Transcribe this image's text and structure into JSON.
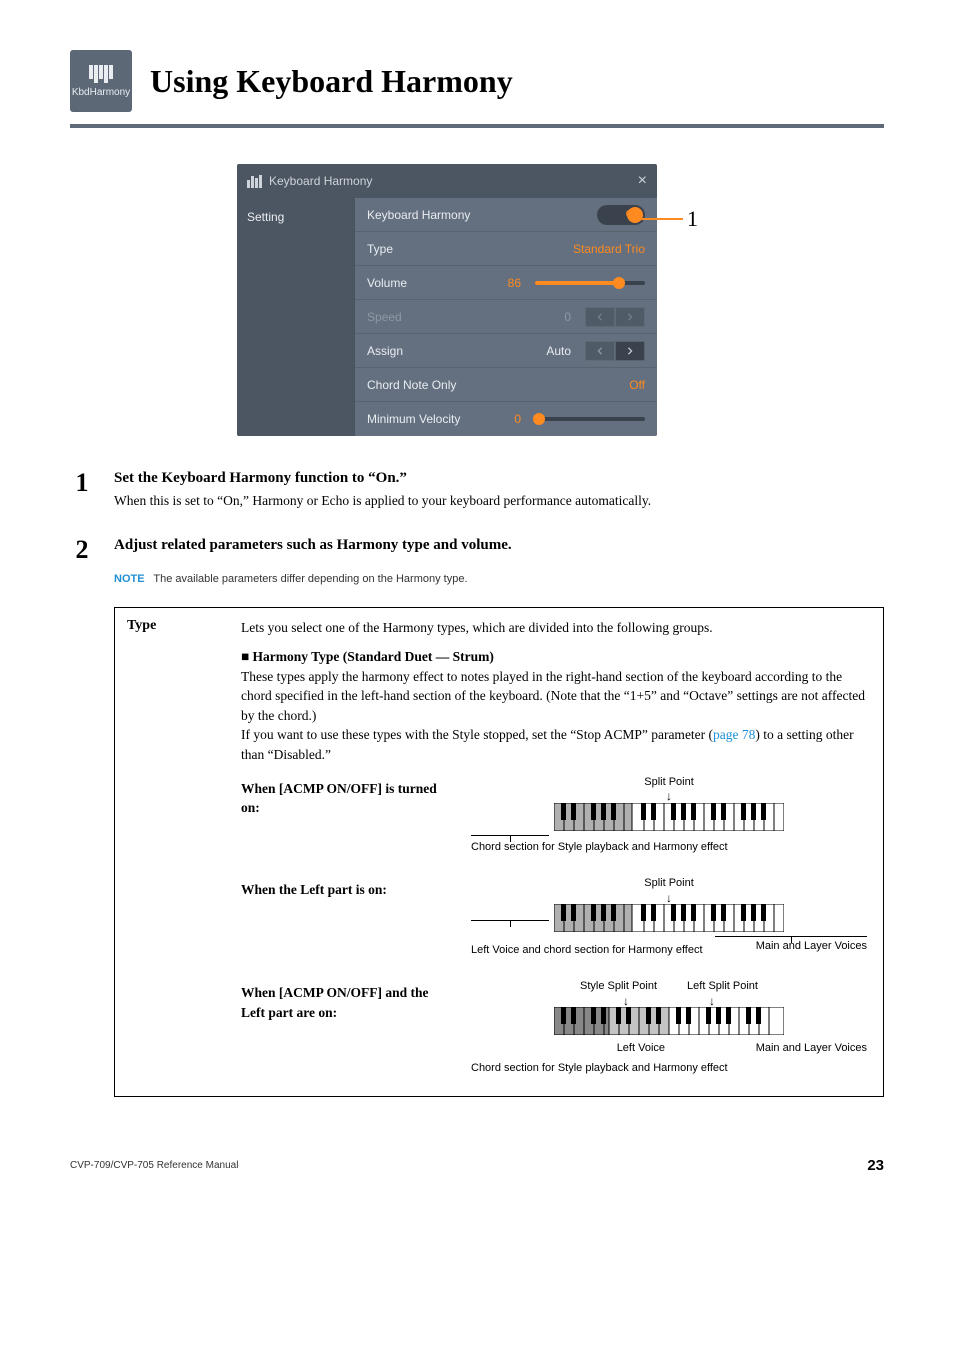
{
  "header": {
    "icon_label": "KbdHarmony",
    "title": "Using Keyboard Harmony"
  },
  "shot": {
    "window_title": "Keyboard Harmony",
    "sidebar_label": "Setting",
    "rows": {
      "kh_label": "Keyboard Harmony",
      "kh_toggle": "On",
      "type_label": "Type",
      "type_value": "Standard Trio",
      "volume_label": "Volume",
      "volume_value": "86",
      "speed_label": "Speed",
      "speed_value": "0",
      "assign_label": "Assign",
      "assign_value": "Auto",
      "chord_label": "Chord Note Only",
      "chord_value": "Off",
      "minvel_label": "Minimum Velocity",
      "minvel_value": "0"
    },
    "callout_num": "1"
  },
  "steps": {
    "s1_num": "1",
    "s1_h": "Set the Keyboard Harmony function to “On.”",
    "s1_p": "When this is set to “On,” Harmony or Echo is applied to your keyboard performance automatically.",
    "s2_num": "2",
    "s2_h": "Adjust related parameters such as Harmony type and volume."
  },
  "note": {
    "label": "NOTE",
    "text": "The available parameters differ depending on the Harmony type."
  },
  "type_table": {
    "left": "Type",
    "intro": "Lets you select one of the Harmony types, which are divided into the following groups.",
    "sub_h": "Harmony Type (Standard Duet — Strum)",
    "desc": "These types apply the harmony effect to notes played in the right-hand section of the keyboard according to the chord specified in the left-hand section of the keyboard. (Note that the “1+5” and “Octave” settings are not affected by the chord.)\nIf you want to use these types with the Style stopped, set the “Stop ACMP” parameter (",
    "page_ref": "page 78",
    "desc2": ") to a setting other than “Disabled.”",
    "row1_lab": "When [ACMP ON/OFF] is turned on:",
    "row1_sp": "Split Point",
    "row1_cap": "Chord section for Style playback and Harmony effect",
    "row2_lab": "When the Left part is on:",
    "row2_sp": "Split Point",
    "row2_cap_r": "Main and Layer Voices",
    "row2_cap_l": "Left Voice and chord section for Harmony effect",
    "row3_lab": "When [ACMP ON/OFF] and the Left part are on:",
    "row3_sp_l": "Style Split Point",
    "row3_sp_r": "Left Split Point",
    "row3_cap_lv": "Left Voice",
    "row3_cap_ml": "Main and Layer Voices",
    "row3_cap_bot": "Chord section for Style playback and Harmony effect"
  },
  "footer": {
    "left": "CVP-709/CVP-705 Reference Manual",
    "right": "23"
  }
}
